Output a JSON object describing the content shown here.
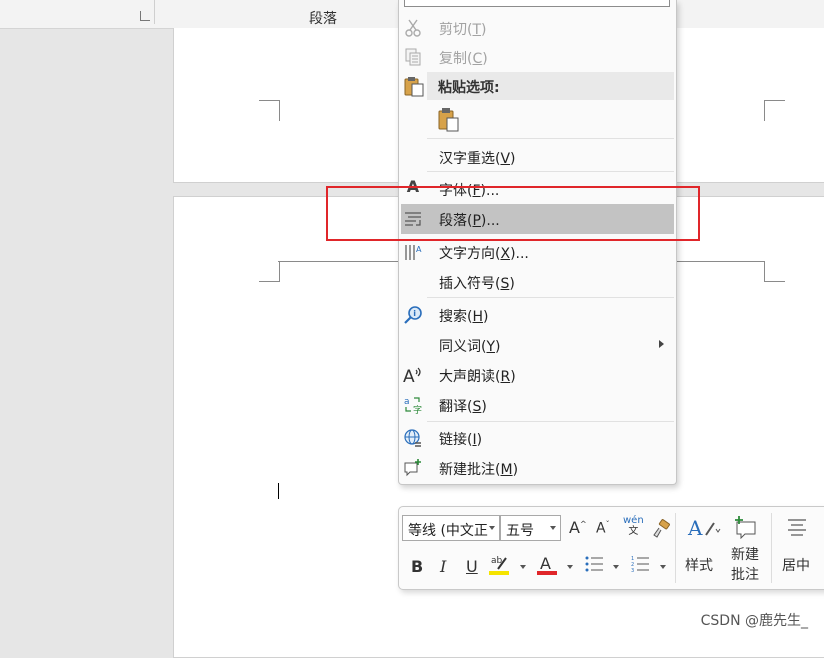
{
  "ribbon": {
    "group_label": "段落"
  },
  "context_menu": {
    "cut": {
      "text": "剪切(",
      "key": "T",
      "tail": ")"
    },
    "copy": {
      "text": "复制(",
      "key": "C",
      "tail": ")"
    },
    "paste_options": "粘贴选项:",
    "hanzi_reselect": {
      "text": "汉字重选(",
      "key": "V",
      "tail": ")"
    },
    "font": {
      "text": "字体(",
      "key": "F",
      "tail": ")..."
    },
    "paragraph": {
      "text": "段落(",
      "key": "P",
      "tail": ")..."
    },
    "text_direction": {
      "text": "文字方向(",
      "key": "X",
      "tail": ")..."
    },
    "insert_symbol": {
      "text": "插入符号(",
      "key": "S",
      "tail": ")"
    },
    "search": {
      "text": "搜索(",
      "key": "H",
      "tail": ")"
    },
    "synonyms": {
      "text": "同义词(",
      "key": "Y",
      "tail": ")"
    },
    "read_aloud": {
      "text": "大声朗读(",
      "key": "R",
      "tail": ")"
    },
    "translate": {
      "text": "翻译(",
      "key": "S",
      "tail": ")"
    },
    "link": {
      "text": "链接(",
      "key": "I",
      "tail": ")"
    },
    "new_comment": {
      "text": "新建批注(",
      "key": "M",
      "tail": ")"
    }
  },
  "mini_toolbar": {
    "font_name": "等线 (中文正",
    "font_size": "五号",
    "phonetic_top": "wén",
    "phonetic_bottom": "文",
    "bold": "B",
    "italic": "I",
    "underline": "U",
    "styles_label": "样式",
    "new_comment_line1": "新建",
    "new_comment_line2": "批注",
    "center_label": "居中",
    "highlight_color": "#f5e400",
    "font_color": "#e0262a"
  },
  "watermark": "CSDN @鹿先生_"
}
